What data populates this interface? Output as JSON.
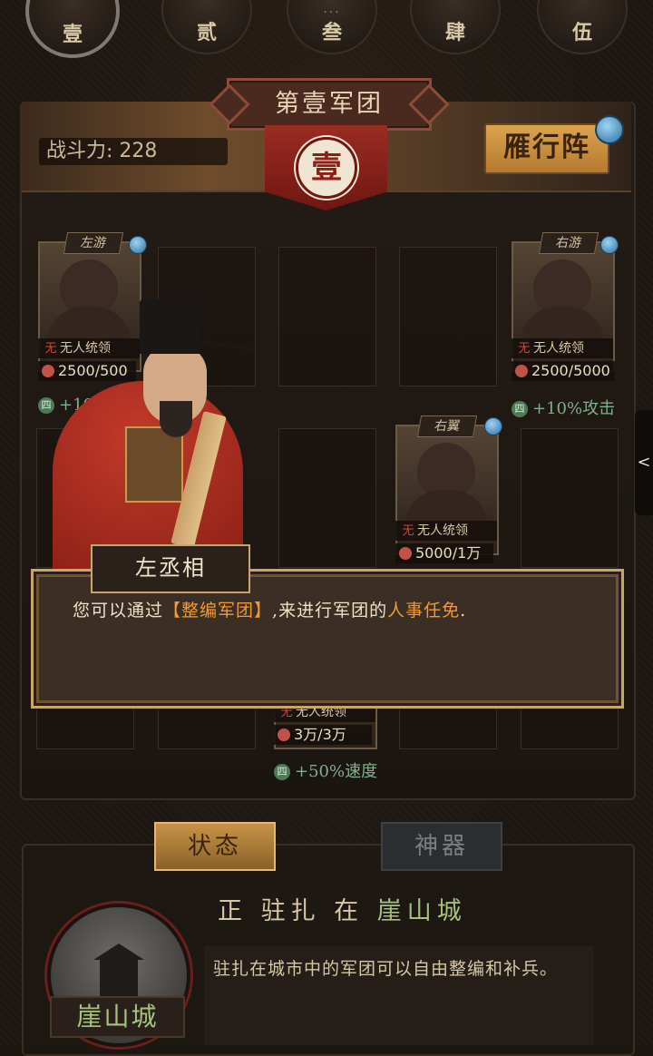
{
  "tabs": [
    "壹",
    "贰",
    "叁",
    "肆",
    "伍"
  ],
  "tab_dots": "...",
  "legion": {
    "title": "第壹军团",
    "seal": "壹",
    "power_label": "战斗力:",
    "power_value": "228",
    "formation": "雁行阵"
  },
  "slots": {
    "left_wing": {
      "position": "左游",
      "commander": "无人统领",
      "troops": "2500/500",
      "bonus": "+10%"
    },
    "right_wing": {
      "position": "右游",
      "commander": "无人统领",
      "troops": "2500/5000",
      "bonus": "+10%攻击"
    },
    "right_flank": {
      "position": "右翼",
      "commander": "无人统领",
      "troops": "5000/1万"
    },
    "center": {
      "commander": "无人统领",
      "troops": "3万/3万",
      "bonus": "+50%速度"
    },
    "wu_char": "无",
    "badge_char": "四"
  },
  "dialog": {
    "speaker": "左丞相",
    "text_prefix": "您可以通过",
    "text_highlight1": "【整编军团】",
    "text_middle": ",来进行军团的",
    "text_highlight2": "人事任免",
    "text_suffix": "."
  },
  "status_tabs": {
    "status": "状态",
    "artifact": "神器"
  },
  "station": {
    "prefix": "正 驻扎 在",
    "city": "崖山城",
    "description": "驻扎在城市中的军团可以自由整编和补兵。"
  },
  "side_handle": "<",
  "colors": {
    "highlight": "#f39a35",
    "city_green": "#a6c07f",
    "accent_red": "#9b2b22",
    "gold": "#caa56a"
  }
}
